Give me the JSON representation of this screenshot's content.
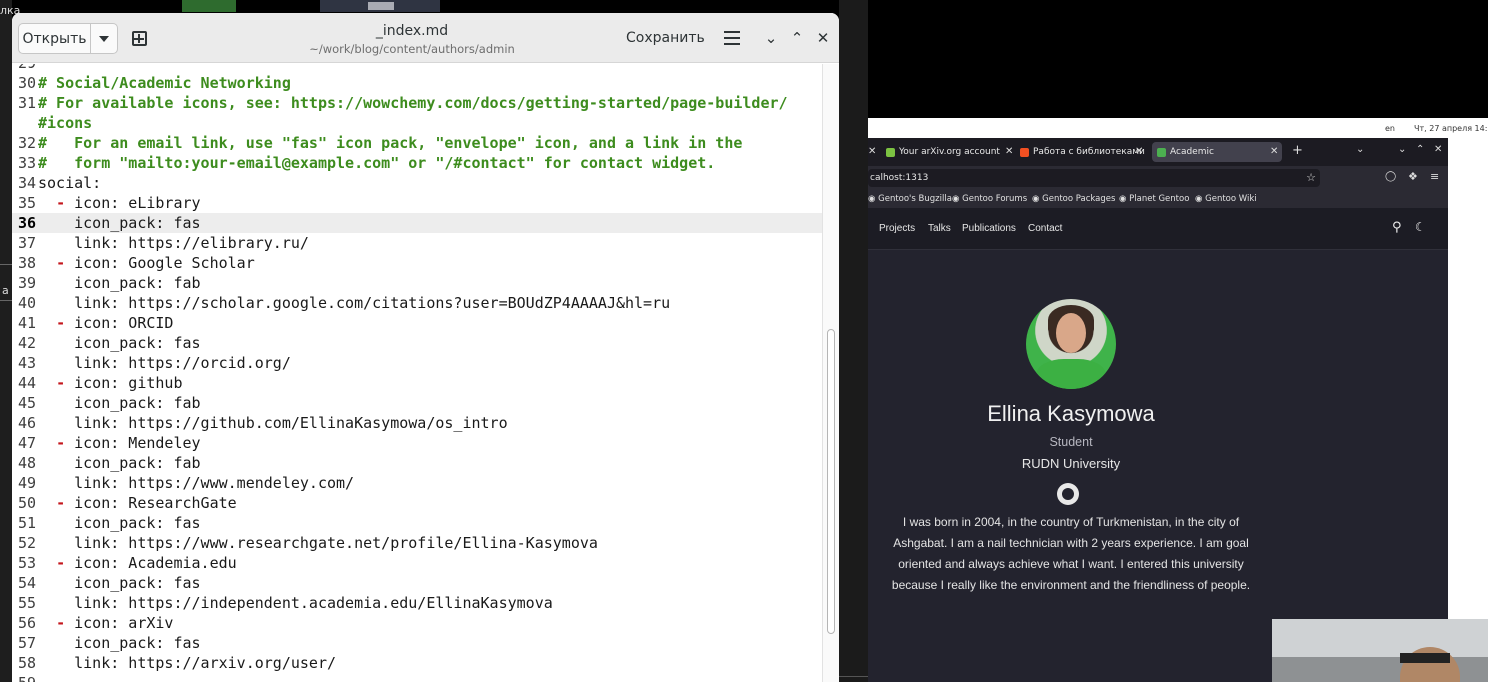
{
  "desktop": {
    "left_text": "лка",
    "left_text2": "a il"
  },
  "editor": {
    "open_label": "Открыть",
    "title": "_index.md",
    "path": "~/work/blog/content/authors/admin",
    "save_label": "Сохранить",
    "lines": [
      {
        "n": "29",
        "parts": [
          {
            "t": "",
            "c": "tx"
          }
        ]
      },
      {
        "n": "30",
        "parts": [
          {
            "t": "# Social/Academic Networking",
            "c": "cmt"
          }
        ]
      },
      {
        "n": "31",
        "parts": [
          {
            "t": "# For available icons, see: https://wowchemy.com/docs/getting-started/page-builder/",
            "c": "cmt"
          }
        ]
      },
      {
        "n": "",
        "parts": [
          {
            "t": "#icons",
            "c": "cmt"
          }
        ]
      },
      {
        "n": "32",
        "parts": [
          {
            "t": "#   For an email link, use \"fas\" icon pack, \"envelope\" icon, and a link in the",
            "c": "cmt"
          }
        ]
      },
      {
        "n": "33",
        "parts": [
          {
            "t": "#   form \"mailto:your-email@example.com\" or \"/#contact\" for contact widget.",
            "c": "cmt"
          }
        ]
      },
      {
        "n": "34",
        "parts": [
          {
            "t": "social:",
            "c": "tx"
          }
        ]
      },
      {
        "n": "35",
        "parts": [
          {
            "t": "  ",
            "c": "tx"
          },
          {
            "t": "-",
            "c": "dash"
          },
          {
            "t": " icon: eLibrary",
            "c": "tx"
          }
        ]
      },
      {
        "n": "36",
        "cur": true,
        "parts": [
          {
            "t": "    icon_pack: fas",
            "c": "tx"
          }
        ]
      },
      {
        "n": "37",
        "parts": [
          {
            "t": "    link: https://elibrary.ru/",
            "c": "tx"
          }
        ]
      },
      {
        "n": "38",
        "parts": [
          {
            "t": "  ",
            "c": "tx"
          },
          {
            "t": "-",
            "c": "dash"
          },
          {
            "t": " icon: Google Scholar",
            "c": "tx"
          }
        ]
      },
      {
        "n": "39",
        "parts": [
          {
            "t": "    icon_pack: fab",
            "c": "tx"
          }
        ]
      },
      {
        "n": "40",
        "parts": [
          {
            "t": "    link: https://scholar.google.com/citations?user=BOUdZP4AAAAJ&hl=ru",
            "c": "tx"
          }
        ]
      },
      {
        "n": "41",
        "parts": [
          {
            "t": "  ",
            "c": "tx"
          },
          {
            "t": "-",
            "c": "dash"
          },
          {
            "t": " icon: ORCID",
            "c": "tx"
          }
        ]
      },
      {
        "n": "42",
        "parts": [
          {
            "t": "    icon_pack: fas",
            "c": "tx"
          }
        ]
      },
      {
        "n": "43",
        "parts": [
          {
            "t": "    link: https://orcid.org/",
            "c": "tx"
          }
        ]
      },
      {
        "n": "44",
        "parts": [
          {
            "t": "  ",
            "c": "tx"
          },
          {
            "t": "-",
            "c": "dash"
          },
          {
            "t": " icon: github",
            "c": "tx"
          }
        ]
      },
      {
        "n": "45",
        "parts": [
          {
            "t": "    icon_pack: fab",
            "c": "tx"
          }
        ]
      },
      {
        "n": "46",
        "parts": [
          {
            "t": "    link: https://github.com/EllinaKasymowa/os_intro",
            "c": "tx"
          }
        ]
      },
      {
        "n": "47",
        "parts": [
          {
            "t": "  ",
            "c": "tx"
          },
          {
            "t": "-",
            "c": "dash"
          },
          {
            "t": " icon: Mendeley",
            "c": "tx"
          }
        ]
      },
      {
        "n": "48",
        "parts": [
          {
            "t": "    icon_pack: fab",
            "c": "tx"
          }
        ]
      },
      {
        "n": "49",
        "parts": [
          {
            "t": "    link: https://www.mendeley.com/",
            "c": "tx"
          }
        ]
      },
      {
        "n": "50",
        "parts": [
          {
            "t": "  ",
            "c": "tx"
          },
          {
            "t": "-",
            "c": "dash"
          },
          {
            "t": " icon: ResearchGate",
            "c": "tx"
          }
        ]
      },
      {
        "n": "51",
        "parts": [
          {
            "t": "    icon_pack: fas",
            "c": "tx"
          }
        ]
      },
      {
        "n": "52",
        "parts": [
          {
            "t": "    link: https://www.researchgate.net/profile/Ellina-Kasymova",
            "c": "tx"
          }
        ]
      },
      {
        "n": "53",
        "parts": [
          {
            "t": "  ",
            "c": "tx"
          },
          {
            "t": "-",
            "c": "dash"
          },
          {
            "t": " icon: Academia.edu",
            "c": "tx"
          }
        ]
      },
      {
        "n": "54",
        "parts": [
          {
            "t": "    icon_pack: fas",
            "c": "tx"
          }
        ]
      },
      {
        "n": "55",
        "parts": [
          {
            "t": "    link: https://independent.academia.edu/EllinaKasymova",
            "c": "tx"
          }
        ]
      },
      {
        "n": "56",
        "parts": [
          {
            "t": "  ",
            "c": "tx"
          },
          {
            "t": "-",
            "c": "dash"
          },
          {
            "t": " icon: arXiv",
            "c": "tx"
          }
        ]
      },
      {
        "n": "57",
        "parts": [
          {
            "t": "    icon_pack: fas",
            "c": "tx"
          }
        ]
      },
      {
        "n": "58",
        "parts": [
          {
            "t": "    link: https://arxiv.org/user/",
            "c": "tx"
          }
        ]
      },
      {
        "n": "59",
        "parts": [
          {
            "t": "",
            "c": "tx"
          }
        ]
      }
    ]
  },
  "system": {
    "lang": "en",
    "clock": "Чт, 27 апреля  14:"
  },
  "browser": {
    "tabs": [
      {
        "label": "Your arXiv.org account",
        "fav_color": "#7cc242"
      },
      {
        "label": "Работа с библиотеками",
        "fav_color": "#f25022"
      },
      {
        "label": "Academic",
        "fav_color": "#4caf50"
      }
    ],
    "url": "calhost:1313",
    "bookmarks": [
      "Gentoo's Bugzilla",
      "Gentoo Forums",
      "Gentoo Packages",
      "Planet Gentoo",
      "Gentoo Wiki"
    ],
    "nav": [
      "Projects",
      "Talks",
      "Publications",
      "Contact"
    ],
    "profile": {
      "name": "Ellina Kasymowa",
      "role": "Student",
      "org": "RUDN University",
      "bio": "I was born in 2004, in the country of Turkmenistan, in the city of Ashgabat. I am a nail technician with 2 years experience. I am goal oriented and always achieve what I want. I entered this university because I really like the environment and the friendliness of people."
    }
  }
}
